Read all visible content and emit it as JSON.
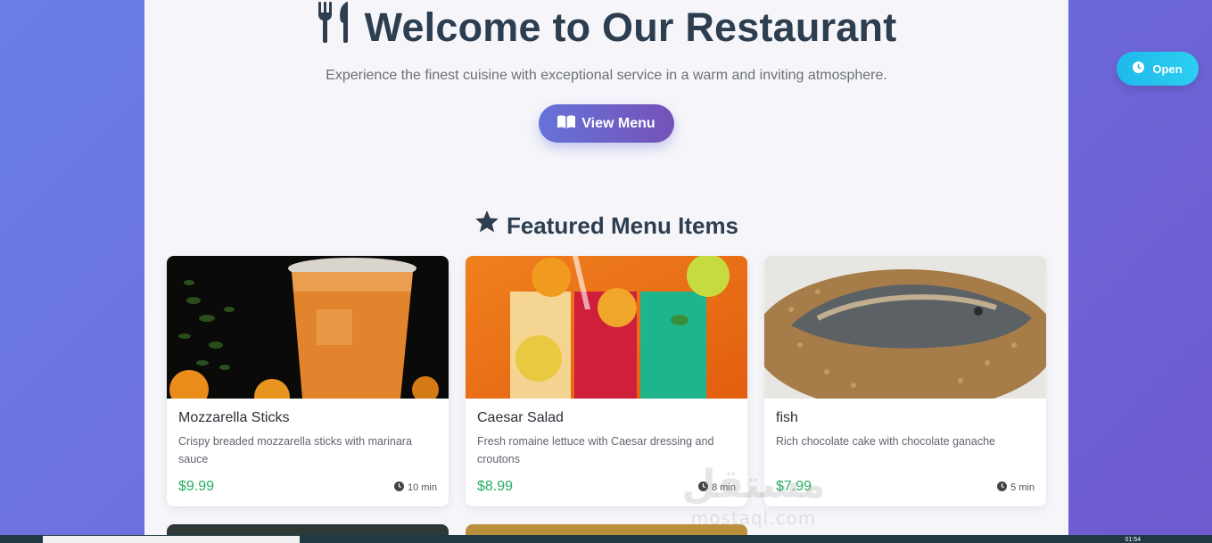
{
  "hero": {
    "title": "Welcome to Our Restaurant",
    "subtitle": "Experience the finest cuisine with exceptional service in a warm and inviting atmosphere.",
    "cta_label": "View Menu",
    "title_icon": "utensils-icon",
    "cta_icon": "book-open-icon"
  },
  "featured": {
    "title": "Featured Menu Items",
    "title_icon": "star-icon",
    "items": [
      {
        "name": "Mozzarella Sticks",
        "description": "Crispy breaded mozzarella sticks with marinara sauce",
        "price": "$9.99",
        "time": "10 min",
        "image": "iced-drink-photo"
      },
      {
        "name": "Caesar Salad",
        "description": "Fresh romaine lettuce with Caesar dressing and croutons",
        "price": "$8.99",
        "time": "8 min",
        "image": "colorful-drinks-photo"
      },
      {
        "name": "fish",
        "description": "Rich chocolate cake with chocolate ganache",
        "price": "$7.99",
        "time": "5 min",
        "image": "fish-rice-photo"
      }
    ]
  },
  "status_badge": {
    "label": "Open",
    "icon": "clock-icon"
  },
  "watermark": {
    "arabic": "مستقل",
    "latin": "mostaql.com"
  },
  "taskbar": {
    "clock": "01:54"
  },
  "colors": {
    "background_start": "#6a7ee8",
    "background_end": "#6f5ad0",
    "heading": "#2c3e50",
    "price": "#27ae60",
    "badge": "#1fb8ea"
  }
}
